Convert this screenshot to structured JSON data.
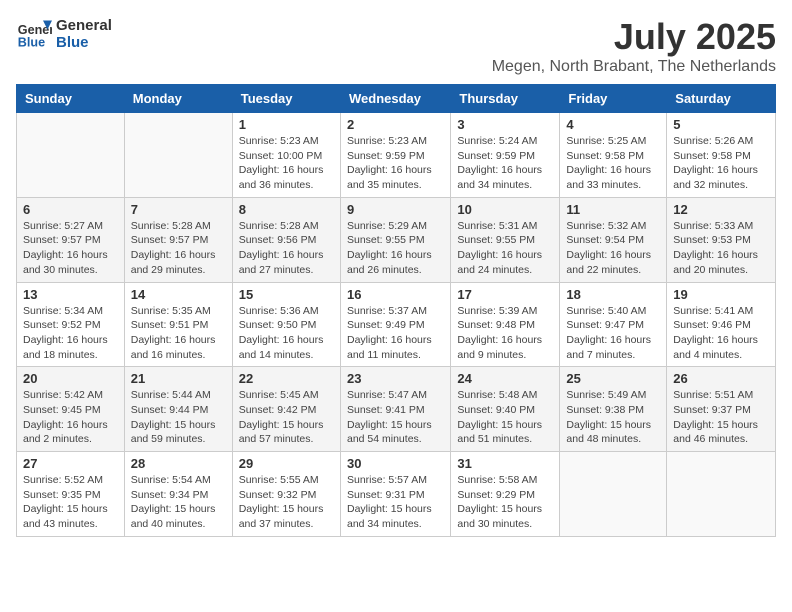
{
  "header": {
    "logo_line1": "General",
    "logo_line2": "Blue",
    "month_year": "July 2025",
    "location": "Megen, North Brabant, The Netherlands"
  },
  "weekdays": [
    "Sunday",
    "Monday",
    "Tuesday",
    "Wednesday",
    "Thursday",
    "Friday",
    "Saturday"
  ],
  "weeks": [
    [
      {
        "day": "",
        "info": ""
      },
      {
        "day": "",
        "info": ""
      },
      {
        "day": "1",
        "info": "Sunrise: 5:23 AM\nSunset: 10:00 PM\nDaylight: 16 hours\nand 36 minutes."
      },
      {
        "day": "2",
        "info": "Sunrise: 5:23 AM\nSunset: 9:59 PM\nDaylight: 16 hours\nand 35 minutes."
      },
      {
        "day": "3",
        "info": "Sunrise: 5:24 AM\nSunset: 9:59 PM\nDaylight: 16 hours\nand 34 minutes."
      },
      {
        "day": "4",
        "info": "Sunrise: 5:25 AM\nSunset: 9:58 PM\nDaylight: 16 hours\nand 33 minutes."
      },
      {
        "day": "5",
        "info": "Sunrise: 5:26 AM\nSunset: 9:58 PM\nDaylight: 16 hours\nand 32 minutes."
      }
    ],
    [
      {
        "day": "6",
        "info": "Sunrise: 5:27 AM\nSunset: 9:57 PM\nDaylight: 16 hours\nand 30 minutes."
      },
      {
        "day": "7",
        "info": "Sunrise: 5:28 AM\nSunset: 9:57 PM\nDaylight: 16 hours\nand 29 minutes."
      },
      {
        "day": "8",
        "info": "Sunrise: 5:28 AM\nSunset: 9:56 PM\nDaylight: 16 hours\nand 27 minutes."
      },
      {
        "day": "9",
        "info": "Sunrise: 5:29 AM\nSunset: 9:55 PM\nDaylight: 16 hours\nand 26 minutes."
      },
      {
        "day": "10",
        "info": "Sunrise: 5:31 AM\nSunset: 9:55 PM\nDaylight: 16 hours\nand 24 minutes."
      },
      {
        "day": "11",
        "info": "Sunrise: 5:32 AM\nSunset: 9:54 PM\nDaylight: 16 hours\nand 22 minutes."
      },
      {
        "day": "12",
        "info": "Sunrise: 5:33 AM\nSunset: 9:53 PM\nDaylight: 16 hours\nand 20 minutes."
      }
    ],
    [
      {
        "day": "13",
        "info": "Sunrise: 5:34 AM\nSunset: 9:52 PM\nDaylight: 16 hours\nand 18 minutes."
      },
      {
        "day": "14",
        "info": "Sunrise: 5:35 AM\nSunset: 9:51 PM\nDaylight: 16 hours\nand 16 minutes."
      },
      {
        "day": "15",
        "info": "Sunrise: 5:36 AM\nSunset: 9:50 PM\nDaylight: 16 hours\nand 14 minutes."
      },
      {
        "day": "16",
        "info": "Sunrise: 5:37 AM\nSunset: 9:49 PM\nDaylight: 16 hours\nand 11 minutes."
      },
      {
        "day": "17",
        "info": "Sunrise: 5:39 AM\nSunset: 9:48 PM\nDaylight: 16 hours\nand 9 minutes."
      },
      {
        "day": "18",
        "info": "Sunrise: 5:40 AM\nSunset: 9:47 PM\nDaylight: 16 hours\nand 7 minutes."
      },
      {
        "day": "19",
        "info": "Sunrise: 5:41 AM\nSunset: 9:46 PM\nDaylight: 16 hours\nand 4 minutes."
      }
    ],
    [
      {
        "day": "20",
        "info": "Sunrise: 5:42 AM\nSunset: 9:45 PM\nDaylight: 16 hours\nand 2 minutes."
      },
      {
        "day": "21",
        "info": "Sunrise: 5:44 AM\nSunset: 9:44 PM\nDaylight: 15 hours\nand 59 minutes."
      },
      {
        "day": "22",
        "info": "Sunrise: 5:45 AM\nSunset: 9:42 PM\nDaylight: 15 hours\nand 57 minutes."
      },
      {
        "day": "23",
        "info": "Sunrise: 5:47 AM\nSunset: 9:41 PM\nDaylight: 15 hours\nand 54 minutes."
      },
      {
        "day": "24",
        "info": "Sunrise: 5:48 AM\nSunset: 9:40 PM\nDaylight: 15 hours\nand 51 minutes."
      },
      {
        "day": "25",
        "info": "Sunrise: 5:49 AM\nSunset: 9:38 PM\nDaylight: 15 hours\nand 48 minutes."
      },
      {
        "day": "26",
        "info": "Sunrise: 5:51 AM\nSunset: 9:37 PM\nDaylight: 15 hours\nand 46 minutes."
      }
    ],
    [
      {
        "day": "27",
        "info": "Sunrise: 5:52 AM\nSunset: 9:35 PM\nDaylight: 15 hours\nand 43 minutes."
      },
      {
        "day": "28",
        "info": "Sunrise: 5:54 AM\nSunset: 9:34 PM\nDaylight: 15 hours\nand 40 minutes."
      },
      {
        "day": "29",
        "info": "Sunrise: 5:55 AM\nSunset: 9:32 PM\nDaylight: 15 hours\nand 37 minutes."
      },
      {
        "day": "30",
        "info": "Sunrise: 5:57 AM\nSunset: 9:31 PM\nDaylight: 15 hours\nand 34 minutes."
      },
      {
        "day": "31",
        "info": "Sunrise: 5:58 AM\nSunset: 9:29 PM\nDaylight: 15 hours\nand 30 minutes."
      },
      {
        "day": "",
        "info": ""
      },
      {
        "day": "",
        "info": ""
      }
    ]
  ]
}
